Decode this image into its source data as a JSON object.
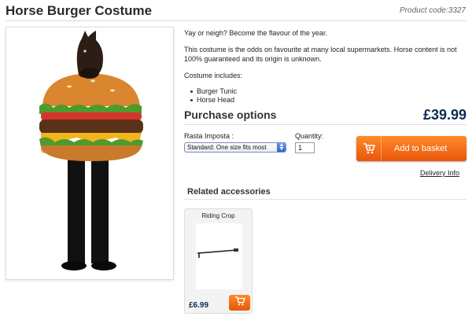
{
  "page": {
    "title": "Horse Burger Costume",
    "product_code": "Product code:3327"
  },
  "description": {
    "tagline": "Yay or neigh? Become the flavour of the year.",
    "body": "This costume is the odds on favourite at many local supermarkets. Horse content is not 100% guaranteed and its origin is unknown.",
    "includes_label": "Costume includes:",
    "includes": [
      "Burger Tunic",
      "Horse Head"
    ]
  },
  "purchase": {
    "title": "Purchase options",
    "price": "£39.99",
    "variant_label": "Rasta Imposta :",
    "variant_selected": "Standard: One size fits most",
    "quantity_label": "Quantity:",
    "quantity_value": "1",
    "add_to_basket": "Add to basket",
    "delivery_info": "Delivery Info"
  },
  "related": {
    "title": "Related accessories",
    "items": [
      {
        "name": "Riding Crop",
        "price": "£6.99",
        "icon": "basket-icon"
      }
    ]
  },
  "colors": {
    "accent_orange": "#f26a14",
    "price_navy": "#0d2b55"
  }
}
